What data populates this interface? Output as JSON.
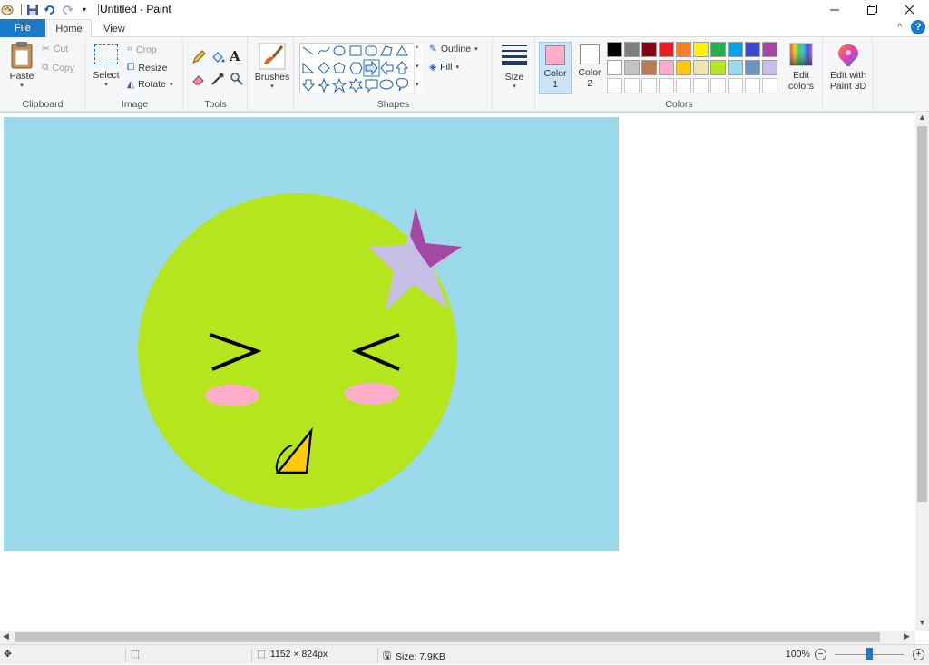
{
  "window": {
    "title": "Untitled - Paint",
    "qat_save_icon": "save-icon",
    "qat_undo_icon": "undo-icon",
    "qat_redo_icon": "redo-icon"
  },
  "tabs": [
    {
      "label": "File"
    },
    {
      "label": "Home"
    },
    {
      "label": "View"
    }
  ],
  "ribbon": {
    "clipboard": {
      "paste": "Paste",
      "cut": "Cut",
      "copy": "Copy",
      "group": "Clipboard"
    },
    "image": {
      "select": "Select",
      "crop": "Crop",
      "resize": "Resize",
      "rotate": "Rotate",
      "group": "Image"
    },
    "tools": {
      "group": "Tools"
    },
    "brushes": {
      "label": "Brushes"
    },
    "shapes": {
      "outline": "Outline",
      "fill": "Fill",
      "group": "Shapes"
    },
    "size": {
      "label": "Size"
    },
    "colors": {
      "color1_line1": "Color",
      "color1_line2": "1",
      "color2_line1": "Color",
      "color2_line2": "2",
      "color1_value": "#ffaec9",
      "color2_value": "#ffffff",
      "edit_colors_line1": "Edit",
      "edit_colors_line2": "colors",
      "group": "Colors",
      "palette": [
        "#000000",
        "#7f7f7f",
        "#880015",
        "#ed1c24",
        "#ff7f27",
        "#fff200",
        "#22b14c",
        "#00a2e8",
        "#3f48cc",
        "#a349a4",
        "#ffffff",
        "#c3c3c3",
        "#b97a57",
        "#ffaec9",
        "#ffc90e",
        "#efe4b0",
        "#b5e61d",
        "#99d9ea",
        "#7092be",
        "#c8bfe7",
        "#ffffff",
        "#ffffff",
        "#ffffff",
        "#ffffff",
        "#ffffff",
        "#ffffff",
        "#ffffff",
        "#ffffff",
        "#ffffff",
        "#ffffff"
      ]
    },
    "paint3d": {
      "line1": "Edit with",
      "line2": "Paint 3D"
    }
  },
  "drawing": {
    "background": "#99d9ea",
    "face_color": "#b5e61d",
    "blush_color": "#ffaec9",
    "star_color": "#c8bfe7",
    "star_accent": "#a349a4",
    "beak_color": "#ffc90e"
  },
  "status": {
    "dimensions": "1152 × 824px",
    "size": "Size: 7.9KB",
    "zoom": "100%"
  }
}
